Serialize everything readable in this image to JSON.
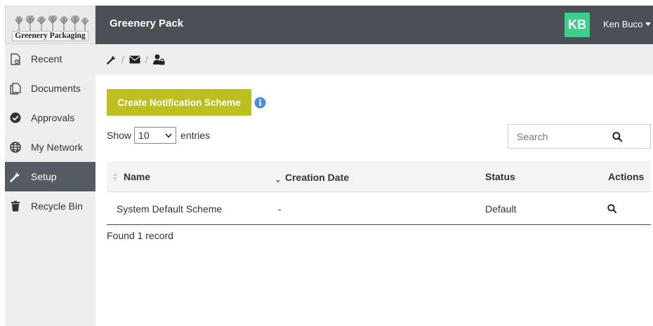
{
  "logo": {
    "text": "Greenery Packaging"
  },
  "sidebar": {
    "items": [
      {
        "label": "Recent",
        "icon": "recent-file-icon"
      },
      {
        "label": "Documents",
        "icon": "documents-icon"
      },
      {
        "label": "Approvals",
        "icon": "check-circle-icon"
      },
      {
        "label": "My Network",
        "icon": "globe-icon"
      },
      {
        "label": "Setup",
        "icon": "wrench-icon",
        "active": true
      },
      {
        "label": "Recycle Bin",
        "icon": "trash-icon"
      }
    ]
  },
  "header": {
    "title": "Greenery Pack",
    "avatar_initials": "KB",
    "user_name": "Ken Buco",
    "accent_color": "#3ecf8e"
  },
  "breadcrumb": {
    "items": [
      "wrench-icon",
      "envelope-icon",
      "user-lock-icon"
    ],
    "separator": "/"
  },
  "main": {
    "create_button": "Create Notification Scheme",
    "show_label": "Show",
    "entries_value": "10",
    "entries_label": "entries",
    "search_placeholder": "Search",
    "table": {
      "columns": [
        "Name",
        "Creation Date",
        "Status",
        "Actions"
      ],
      "rows": [
        {
          "name": "System Default Scheme",
          "creation_date": "-",
          "status": "Default",
          "action_icon": "search-icon"
        }
      ]
    },
    "found_text": "Found 1 record"
  },
  "colors": {
    "topbar": "#4a5056",
    "sidebar_active": "#545b62",
    "button": "#bcbf1e",
    "info": "#4a90d9"
  }
}
